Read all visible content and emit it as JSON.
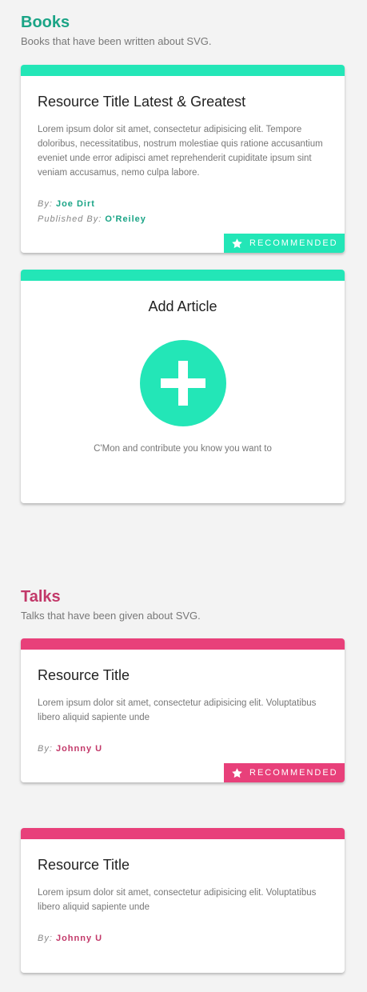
{
  "colors": {
    "books_accent": "#23e6b7",
    "books_text": "#1aa486",
    "talks_accent": "#e8407a",
    "talks_text": "#c23869"
  },
  "books": {
    "title": "Books",
    "subtitle": "Books that have been written about SVG.",
    "card1": {
      "title": "Resource Title Latest & Greatest",
      "description": "Lorem ipsum dolor sit amet, consectetur adipisicing elit. Tempore doloribus, necessitatibus, nostrum molestiae quis ratione accusantium eveniet unde error adipisci amet reprehenderit cupiditate ipsum sint veniam accusamus, nemo culpa labore.",
      "by_label": "By:",
      "author": "Joe Dirt",
      "published_label": "Published By:",
      "publisher": "O'Reiley",
      "badge": "RECOMMENDED",
      "badge_icon": "star-icon"
    },
    "add": {
      "title": "Add Article",
      "icon": "plus-icon",
      "text": "C'Mon and contribute you know you want to"
    }
  },
  "talks": {
    "title": "Talks",
    "subtitle": "Talks that have been given about SVG.",
    "card1": {
      "title": "Resource Title",
      "description": "Lorem ipsum dolor sit amet, consectetur adipisicing elit. Voluptatibus libero aliquid sapiente unde",
      "by_label": "By:",
      "author": "Johnny U",
      "badge": "RECOMMENDED",
      "badge_icon": "star-icon"
    },
    "card2": {
      "title": "Resource Title",
      "description": "Lorem ipsum dolor sit amet, consectetur adipisicing elit. Voluptatibus libero aliquid sapiente unde",
      "by_label": "By:",
      "author": "Johnny U"
    }
  }
}
